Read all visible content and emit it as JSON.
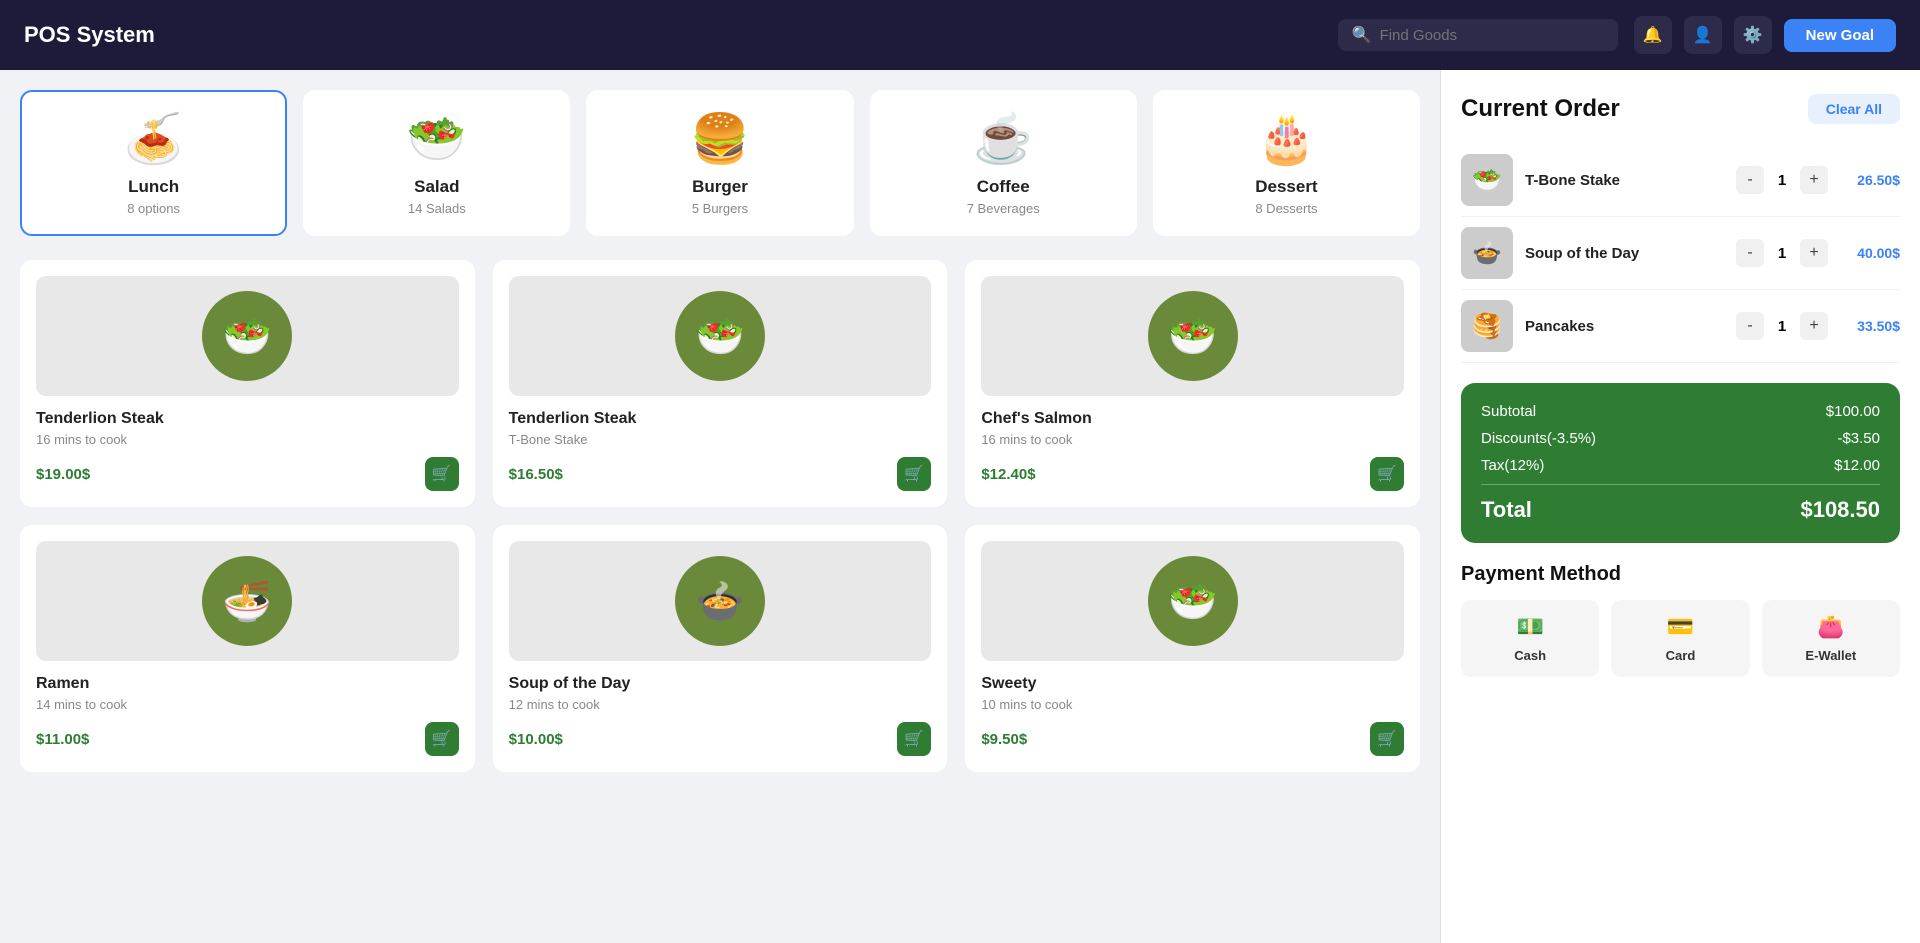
{
  "header": {
    "title": "POS System",
    "search_placeholder": "Find Goods",
    "new_goal_label": "New Goal"
  },
  "categories": [
    {
      "id": "lunch",
      "name": "Lunch",
      "sub": "8 options",
      "icon": "🍝",
      "active": true
    },
    {
      "id": "salad",
      "name": "Salad",
      "sub": "14 Salads",
      "icon": "🥗",
      "active": false
    },
    {
      "id": "burger",
      "name": "Burger",
      "sub": "5 Burgers",
      "icon": "🍔",
      "active": false
    },
    {
      "id": "coffee",
      "name": "Coffee",
      "sub": "7 Beverages",
      "icon": "☕",
      "active": false
    },
    {
      "id": "dessert",
      "name": "Dessert",
      "sub": "8 Desserts",
      "icon": "🎂",
      "active": false
    }
  ],
  "food_items": [
    {
      "name": "Tenderlion Steak",
      "sub": "16 mins to cook",
      "price": "$19.00$",
      "icon": "🥗"
    },
    {
      "name": "Tenderlion Steak",
      "sub": "T-Bone Stake",
      "price": "$16.50$",
      "icon": "🥗"
    },
    {
      "name": "Chef's Salmon",
      "sub": "16 mins to cook",
      "price": "$12.40$",
      "icon": "🥗"
    },
    {
      "name": "Ramen",
      "sub": "14 mins to cook",
      "price": "$11.00$",
      "icon": "🍜"
    },
    {
      "name": "Soup of the Day",
      "sub": "12 mins to cook",
      "price": "$10.00$",
      "icon": "🍲"
    },
    {
      "name": "Sweety",
      "sub": "10 mins to cook",
      "price": "$9.50$",
      "icon": "🥗"
    }
  ],
  "current_order": {
    "title": "Current Order",
    "clear_all_label": "Clear All",
    "items": [
      {
        "name": "T-Bone Stake",
        "qty": 1,
        "price": "26.50$",
        "icon": "🥗"
      },
      {
        "name": "Soup of the Day",
        "qty": 1,
        "price": "40.00$",
        "icon": "🍲"
      },
      {
        "name": "Pancakes",
        "qty": 1,
        "price": "33.50$",
        "icon": "🥞"
      }
    ],
    "subtotal_label": "Subtotal",
    "subtotal_value": "$100.00",
    "discount_label": "Discounts(-3.5%)",
    "discount_value": "-$3.50",
    "tax_label": "Tax(12%)",
    "tax_value": "$12.00",
    "total_label": "Total",
    "total_value": "$108.50"
  },
  "payment": {
    "title": "Payment Method",
    "methods": [
      {
        "label": "Cash",
        "icon": "💵"
      },
      {
        "label": "Card",
        "icon": "💳"
      },
      {
        "label": "E-Wallet",
        "icon": "👛"
      }
    ]
  }
}
